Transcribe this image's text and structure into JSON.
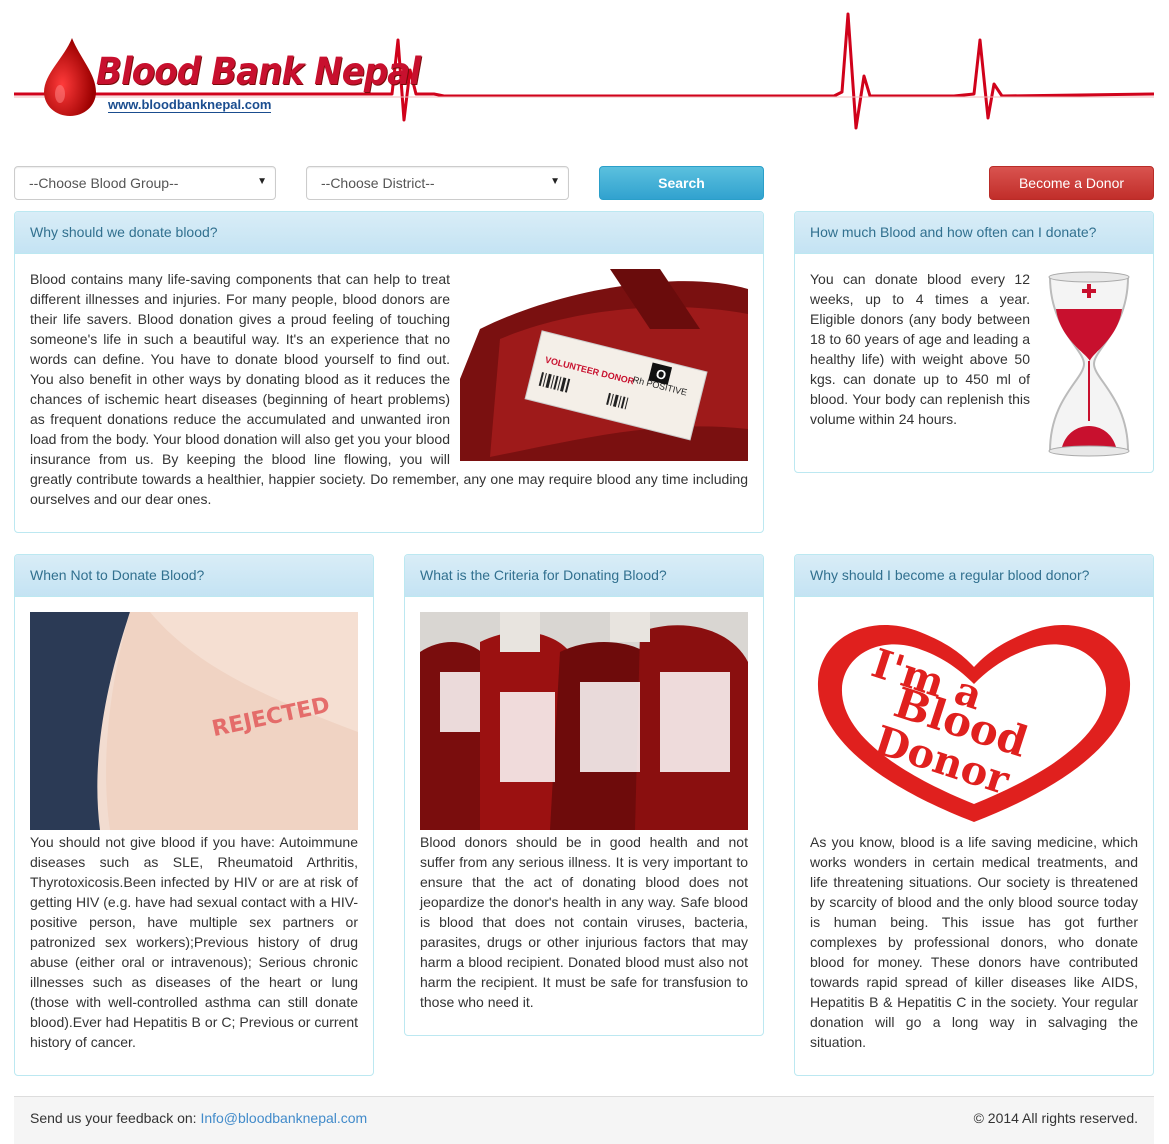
{
  "header": {
    "logo_text": "Blood Bank Nepal",
    "logo_url": "www.bloodbanknepal.com"
  },
  "search": {
    "blood_group_placeholder": "--Choose Blood Group--",
    "district_placeholder": "--Choose District--",
    "search_label": "Search",
    "become_donor_label": "Become a Donor"
  },
  "panels": {
    "why_donate": {
      "title": "Why should we donate blood?",
      "body": "Blood contains many life-saving components that can help to treat different illnesses and injuries. For many people, blood donors are their life savers. Blood donation gives a proud feeling of touching someone's life in such a beautiful way. It's an experience that no words can define. You have to donate blood yourself to find out. You also benefit in other ways by donating blood as it reduces the chances of ischemic heart diseases (beginning of heart problems) as frequent donations reduce the accumulated and unwanted iron load from the body. Your blood donation will also get you your blood insurance from us. By keeping the blood line flowing, you will greatly contribute towards a healthier, happier society. Do remember, any one may require blood any time including ourselves and our dear ones.",
      "image_text_1": "VOLUNTEER DONOR",
      "image_text_2": "Rh POSITIVE",
      "image_text_3": "O"
    },
    "how_much": {
      "title": "How much Blood and how often can I donate?",
      "body": "You can donate blood every 12 weeks, up to 4 times a year. Eligible donors (any body between 18 to 60 years of age and leading a healthy life) with weight above 50 kgs. can donate up to 450 ml of blood. Your body can replenish this volume within 24 hours."
    },
    "when_not": {
      "title": "When Not to Donate Blood?",
      "image_text": "REJECTED",
      "body": "You should not give blood if you have: Autoimmune diseases such as SLE, Rheumatoid Arthritis, Thyrotoxicosis.Been infected by HIV or are at risk of getting HIV (e.g. have had sexual contact with a HIV-positive person, have multiple sex partners or patronized sex workers);Previous history of drug abuse (either oral or intravenous); Serious chronic illnesses such as diseases of the heart or lung (those with well-controlled asthma can still donate blood).Ever had Hepatitis B or C; Previous or current history of cancer."
    },
    "criteria": {
      "title": "What is the Criteria for Donating Blood?",
      "body": "Blood donors should be in good health and not suffer from any serious illness. It is very important to ensure that the act of donating blood does not jeopardize the donor's health in any way. Safe blood is blood that does not contain viruses, bacteria, parasites, drugs or other injurious factors that may harm a blood recipient. Donated blood must also not harm the recipient. It must be safe for transfusion to those who need it."
    },
    "regular": {
      "title": "Why should I become a regular blood donor?",
      "image_text_1": "I'm a",
      "image_text_2": "Blood",
      "image_text_3": "Donor",
      "body": "As you know, blood is a life saving medicine, which works wonders in certain medical treatments, and life threatening situations. Our society is threatened by scarcity of blood and the only blood source today is human being. This issue has got further complexes by professional donors, who donate blood for money. These donors have contributed towards rapid spread of killer diseases like AIDS, Hepatitis B & Hepatitis C in the society. Your regular donation will go a long way in salvaging the situation."
    }
  },
  "footer": {
    "feedback_label": "Send us your feedback on:",
    "feedback_email": "Info@bloodbanknepal.com",
    "copyright": "© 2014 All rights reserved."
  },
  "colors": {
    "brand_red": "#c8102e",
    "panel_heading_bg": "#d9edf7",
    "panel_heading_text": "#31708f",
    "search_button": "#31a2cf",
    "donor_button": "#c12e2a"
  }
}
